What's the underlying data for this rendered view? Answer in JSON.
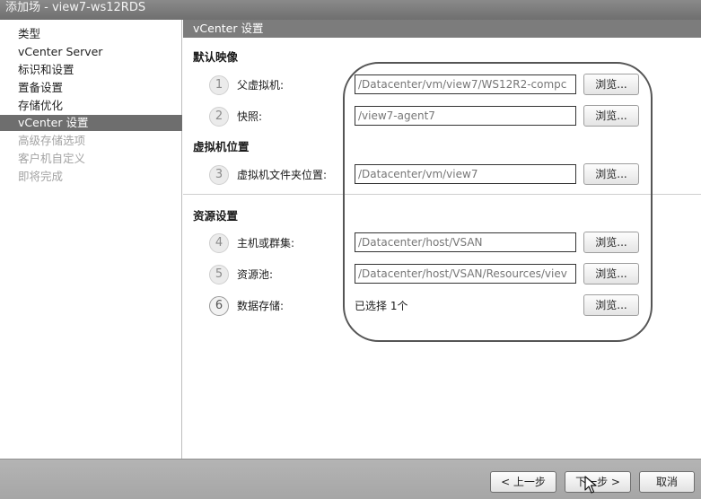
{
  "window": {
    "title": "添加场 - view7-ws12RDS"
  },
  "sidebar": {
    "items": [
      {
        "label": "类型",
        "state": "normal"
      },
      {
        "label": "vCenter Server",
        "state": "normal"
      },
      {
        "label": "标识和设置",
        "state": "normal"
      },
      {
        "label": "置备设置",
        "state": "normal"
      },
      {
        "label": "存储优化",
        "state": "normal"
      },
      {
        "label": "vCenter 设置",
        "state": "active"
      },
      {
        "label": "高级存储选项",
        "state": "disabled"
      },
      {
        "label": "客户机自定义",
        "state": "disabled"
      },
      {
        "label": "即将完成",
        "state": "disabled"
      }
    ]
  },
  "main": {
    "header": "vCenter 设置",
    "sections": {
      "default_image": "默认映像",
      "vm_location": "虚拟机位置",
      "resource_settings": "资源设置"
    },
    "fields": [
      {
        "step": "1",
        "label": "父虚拟机:",
        "value": "/Datacenter/vm/view7/WS12R2-compc",
        "button": "浏览..."
      },
      {
        "step": "2",
        "label": "快照:",
        "value": "/view7-agent7",
        "button": "浏览..."
      },
      {
        "step": "3",
        "label": "虚拟机文件夹位置:",
        "value": "/Datacenter/vm/view7",
        "button": "浏览..."
      },
      {
        "step": "4",
        "label": "主机或群集:",
        "value": "/Datacenter/host/VSAN",
        "button": "浏览..."
      },
      {
        "step": "5",
        "label": "资源池:",
        "value": "/Datacenter/host/VSAN/Resources/viev",
        "button": "浏览..."
      },
      {
        "step": "6",
        "label": "数据存储:",
        "value": "已选择 1个",
        "button": "浏览..."
      }
    ]
  },
  "footer": {
    "back": "< 上一步",
    "next": "下一步 >",
    "cancel": "取消"
  },
  "icons": {
    "cursor": "mouse-pointer-icon"
  }
}
